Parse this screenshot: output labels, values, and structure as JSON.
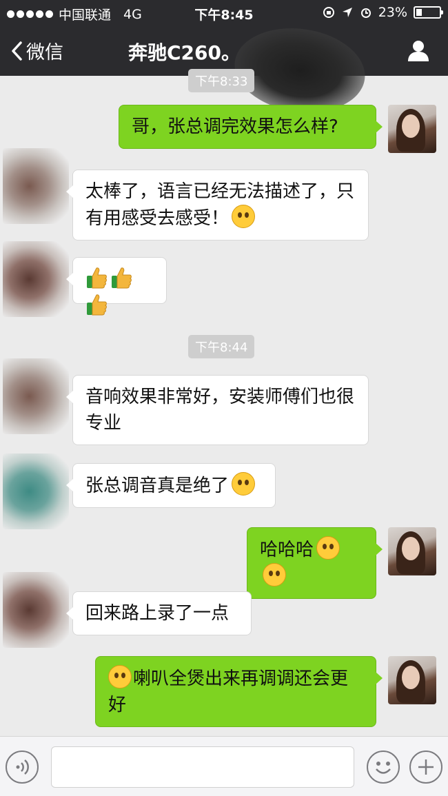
{
  "status_bar": {
    "carrier": "中国联通",
    "network": "4G",
    "time": "下午8:45",
    "battery": "23%"
  },
  "nav": {
    "back_label": "微信",
    "title": "奔驰C260。",
    "back_icon": "chevron-left-icon",
    "profile_icon": "person-icon"
  },
  "chat": {
    "top_time": "下午8:33",
    "mid_time": "下午8:44",
    "messages": [
      {
        "side": "out",
        "text": "哥，张总调完效果怎么样?"
      },
      {
        "side": "in",
        "text": "太棒了，语言已经无法描述了，只有用感受去感受！"
      },
      {
        "side": "in",
        "text": ""
      },
      {
        "side": "in",
        "text": "音响效果非常好，安装师傅们也很专业"
      },
      {
        "side": "in",
        "text": "张总调音真是绝了"
      },
      {
        "side": "out",
        "text": "哈哈哈"
      },
      {
        "side": "in",
        "text": "回来路上录了一点"
      },
      {
        "side": "out",
        "text": "喇叭全煲出来再调调还会更好"
      }
    ]
  },
  "input_bar": {
    "voice_icon": "voice-icon",
    "emoji_icon": "smiley-icon",
    "plus_icon": "plus-icon",
    "placeholder": ""
  },
  "colors": {
    "nav_bg": "#2b2b2e",
    "chat_bg": "#ebebeb",
    "out_bubble": "#7ed321",
    "in_bubble": "#ffffff"
  }
}
